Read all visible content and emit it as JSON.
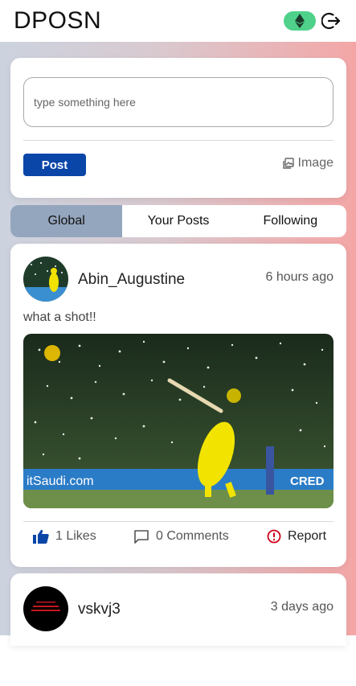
{
  "header": {
    "title": "DPOSN"
  },
  "composer": {
    "placeholder": "type something here",
    "post_label": "Post",
    "image_label": "Image"
  },
  "tabs": [
    {
      "label": "Global",
      "active": true
    },
    {
      "label": "Your Posts",
      "active": false
    },
    {
      "label": "Following",
      "active": false
    }
  ],
  "posts": [
    {
      "username": "Abin_Augustine",
      "time": "6 hours ago",
      "text": "what a shot!!",
      "likes_label": "1 Likes",
      "comments_label": "0 Comments",
      "report_label": "Report",
      "image_banner_text": "itSaudi.com",
      "image_sponsor_text": "CRED"
    },
    {
      "username": "vskvj3",
      "time": "3 days ago"
    }
  ],
  "colors": {
    "accent": "#0a46a8",
    "like": "#0a46a8",
    "report": "#d0021b",
    "eth_pill": "#4fd18b",
    "active_tab": "#94a6bd"
  }
}
